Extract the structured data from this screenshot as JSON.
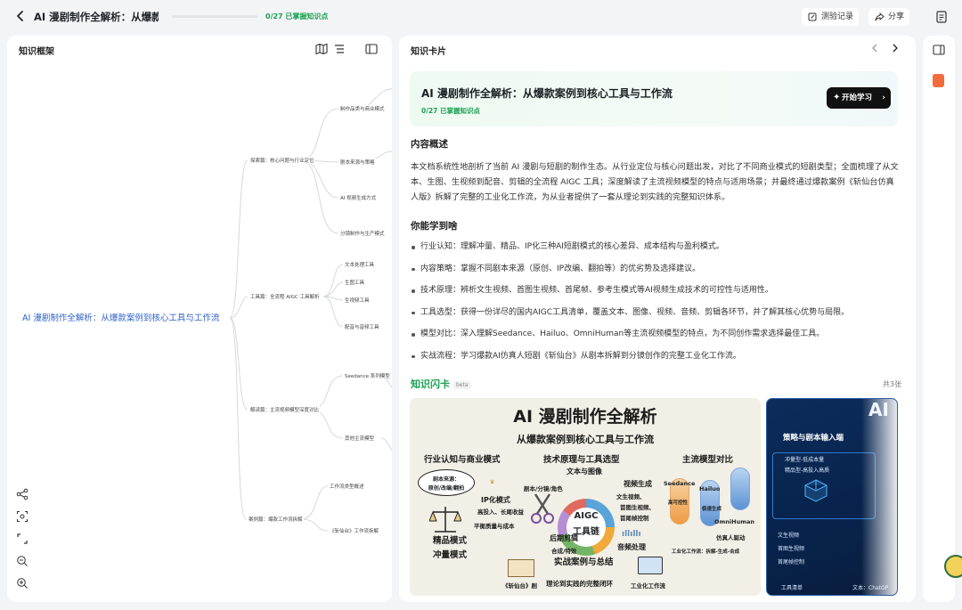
{
  "header": {
    "title": "AI 漫剧制作全解析：从爆款…",
    "progress_text": "0/27 已掌握知识点",
    "progress": 0.0,
    "quiz_record": "测验记录",
    "share": "分享"
  },
  "left_panel": {
    "title": "知识框架",
    "mindmap": {
      "root": "AI 漫剧制作全解析：从爆款案例到核心工具与工作流",
      "branches": [
        {
          "label": "探索篇：核心问题与行业定位",
          "children": [
            "制作品类与商业模式",
            "剧本来源与策略",
            "AI 视频生成方式",
            "分镜制作与生产模式"
          ]
        },
        {
          "label": "工具篇：全流程 AIGC 工具解析",
          "children": [
            "文本处理工具",
            "生图工具",
            "生视频工具",
            "配音与音频工具"
          ]
        },
        {
          "label": "解读篇：主流视频模型深度对比",
          "children": [
            "Seedance 系列模型",
            "其他主流模型"
          ]
        },
        {
          "label": "案例篇：爆款工作流拆解",
          "children": [
            "工作流类型概述",
            "《斩仙台》工作流拆解"
          ]
        }
      ]
    }
  },
  "main": {
    "title": "知识卡片",
    "hero": {
      "title": "AI 漫剧制作全解析：从爆款案例到核心工具与工作流",
      "progress": "0/27 已掌握知识点",
      "start_button": "开始学习"
    },
    "overview_heading": "内容概述",
    "overview": "本文档系统性地剖析了当前 AI 漫剧与短剧的制作生态。从行业定位与核心问题出发，对比了不同商业模式的短剧类型；全面梳理了从文本、生图、生视频到配音、剪辑的全流程 AIGC 工具；深度解读了主流视频模型的特点与适用场景；并最终通过爆款案例《斩仙台仿真人版》拆解了完整的工业化工作流，为从业者提供了一套从理论到实践的完整知识体系。",
    "learn_heading": "你能学到啥",
    "learn_items": [
      "行业认知：理解冲量、精品、IP化三种AI短剧模式的核心差异、成本结构与盈利模式。",
      "内容策略：掌握不同剧本来源（原创、IP改编、翻拍等）的优劣势及选择建议。",
      "技术原理：辨析文生视频、首图生视频、首尾帧、参考生模式等AI视频生成技术的可控性与适用性。",
      "工具选型：获得一份详尽的国内AIGC工具清单，覆盖文本、图像、视频、音频、剪辑各环节，并了解其核心优势与局限。",
      "模型对比：深入理解Seedance、Hailuo、OmniHuman等主流视频模型的特点，为不同创作需求选择最佳工具。",
      "实战流程：学习爆款AI仿真人短剧《斩仙台》从剧本拆解到分镜创作的完整工业化工作流。"
    ],
    "flashcards": {
      "heading": "知识闪卡",
      "beta": "beta",
      "count": "共3张",
      "card1": {
        "title": "AI 漫剧制作全解析",
        "subtitle": "从爆款案例到核心工具与工作流",
        "industry": "行业认知与商业模式",
        "tech": "技术原理与工具选型",
        "models": "主流模型对比",
        "script_bubble_1": "剧本来源：",
        "script_bubble_2": "原创/改编/翻拍",
        "ip_mode": "IP化模式",
        "ip_desc": "高投入、长尾收益",
        "balance": "平衡质量与成本",
        "quality_mode": "精品模式",
        "volume_mode": "冲量模式",
        "text_image": "文本与图像",
        "script_storyboard": "剧本/分镜/角色",
        "aigc_1": "AIGC",
        "aigc_2": "工具链",
        "video_gen": "视频生成",
        "video_desc_1": "文生视频、",
        "video_desc_2": "首图生视频、",
        "video_desc_3": "首尾帧控制",
        "post_edit": "后期剪辑",
        "post_desc": "合成/特效",
        "audio": "音频处理",
        "seedance": "Seedance",
        "seedance_desc": "高可控性",
        "hailuo": "Hailuo",
        "hailuo_desc": "极速生成",
        "omnihuman": "OmniHuman",
        "omni_desc": "仿真人驱动",
        "workflow_desc": "工业化工作流：拆解-生成-合成",
        "case_summary": "实战案例与总结",
        "case_name": "《斩仙台》剧",
        "loop": "理论到实践的完整闭环",
        "industrial": "工业化工作流"
      },
      "card2": {
        "title_partial": "AI",
        "input": "策略与剧本输入端",
        "model_1": "冲量型-低成本量",
        "model_2": "精品型-高投入高质",
        "t2v": "文生视频",
        "i2v": "首图生视频",
        "frame": "首尾帧控制",
        "tool_list": "工具清单",
        "text_tool": "文本：ChatGP"
      }
    }
  },
  "colors": {
    "accent_green": "#1aa053",
    "root_blue": "#2f63c9",
    "dark_button": "#111111"
  }
}
